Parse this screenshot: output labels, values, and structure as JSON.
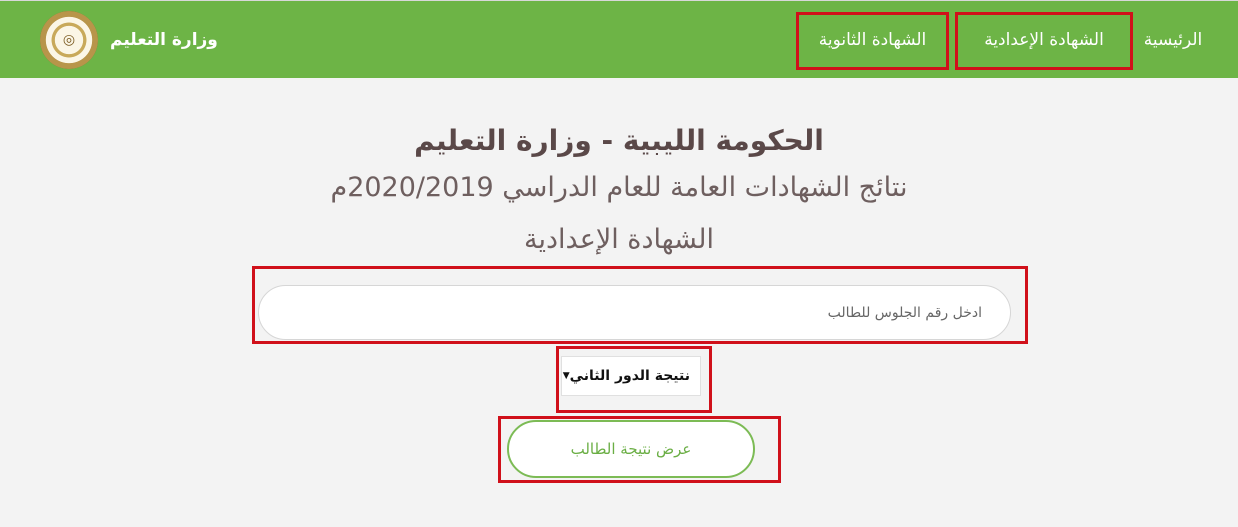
{
  "nav": {
    "home": "الرئيسية",
    "preparatory": "الشهادة الإعدادية",
    "secondary": "الشهادة الثانوية",
    "brand": "وزارة التعليم"
  },
  "header": {
    "line1": "الحكومة الليبية - وزارة التعليم",
    "line2": "نتائج الشهادات العامة للعام الدراسي 2020/2019م",
    "line3": "الشهادة الإعدادية"
  },
  "form": {
    "seat_placeholder": "ادخل رقم الجلوس للطالب",
    "seat_value": "",
    "round_selected": "نتيجة الدور الثاني",
    "submit_label": "عرض نتيجة الطالب"
  },
  "colors": {
    "navbar": "#6db446",
    "highlight": "#d0101a",
    "button_border": "#7cbb55"
  }
}
